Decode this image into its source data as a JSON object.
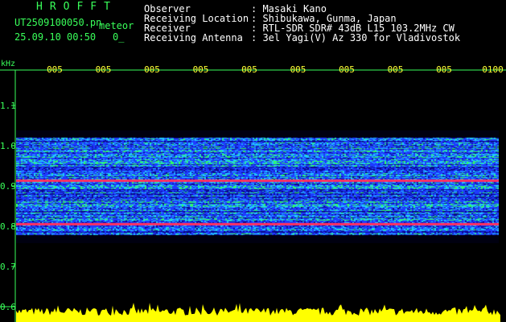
{
  "header": {
    "app_name": "HROFFT",
    "filename": "UT2509100050.pn",
    "mode": "meteor",
    "datetime": "25.09.10 00:50",
    "counter": "0_",
    "observer_label": "Observer",
    "observer_value": ": Masaki Kano",
    "location_label": "Receiving Location",
    "location_value": ": Shibukawa, Gunma, Japan",
    "receiver_label": "Receiver",
    "receiver_value": ": RTL-SDR SDR# 43dB L15 103.2MHz CW",
    "antenna_label": "Receiving Antenna",
    "antenna_value": ": 3el Yagi(V) Az 330 for Vladivostok"
  },
  "colors": {
    "frame": "#39ff5a",
    "info_text": "#ffffff",
    "time_ticks": "#ffff33",
    "background": "#000000",
    "echo_line": "#ff3060",
    "audio_level": "#ffff00"
  },
  "chart_data": {
    "type": "heatmap",
    "y_unit_label": "kHz",
    "y_ticks": [
      "1.1",
      "1.0",
      "0.9",
      "0.8",
      "0.7",
      "0.6"
    ],
    "x_ticks": [
      "005",
      "005",
      "005",
      "005",
      "005",
      "005",
      "005",
      "005",
      "005",
      "0100"
    ],
    "ylim": [
      0.6,
      1.15
    ],
    "signal_band": [
      0.78,
      1.02
    ],
    "strong_lines_khz": [
      0.915,
      0.805
    ],
    "grid": false,
    "colormap": [
      "#000010",
      "#0a0a8c",
      "#1e3cff",
      "#20c8ff",
      "#30ff60",
      "#ff3060"
    ]
  }
}
